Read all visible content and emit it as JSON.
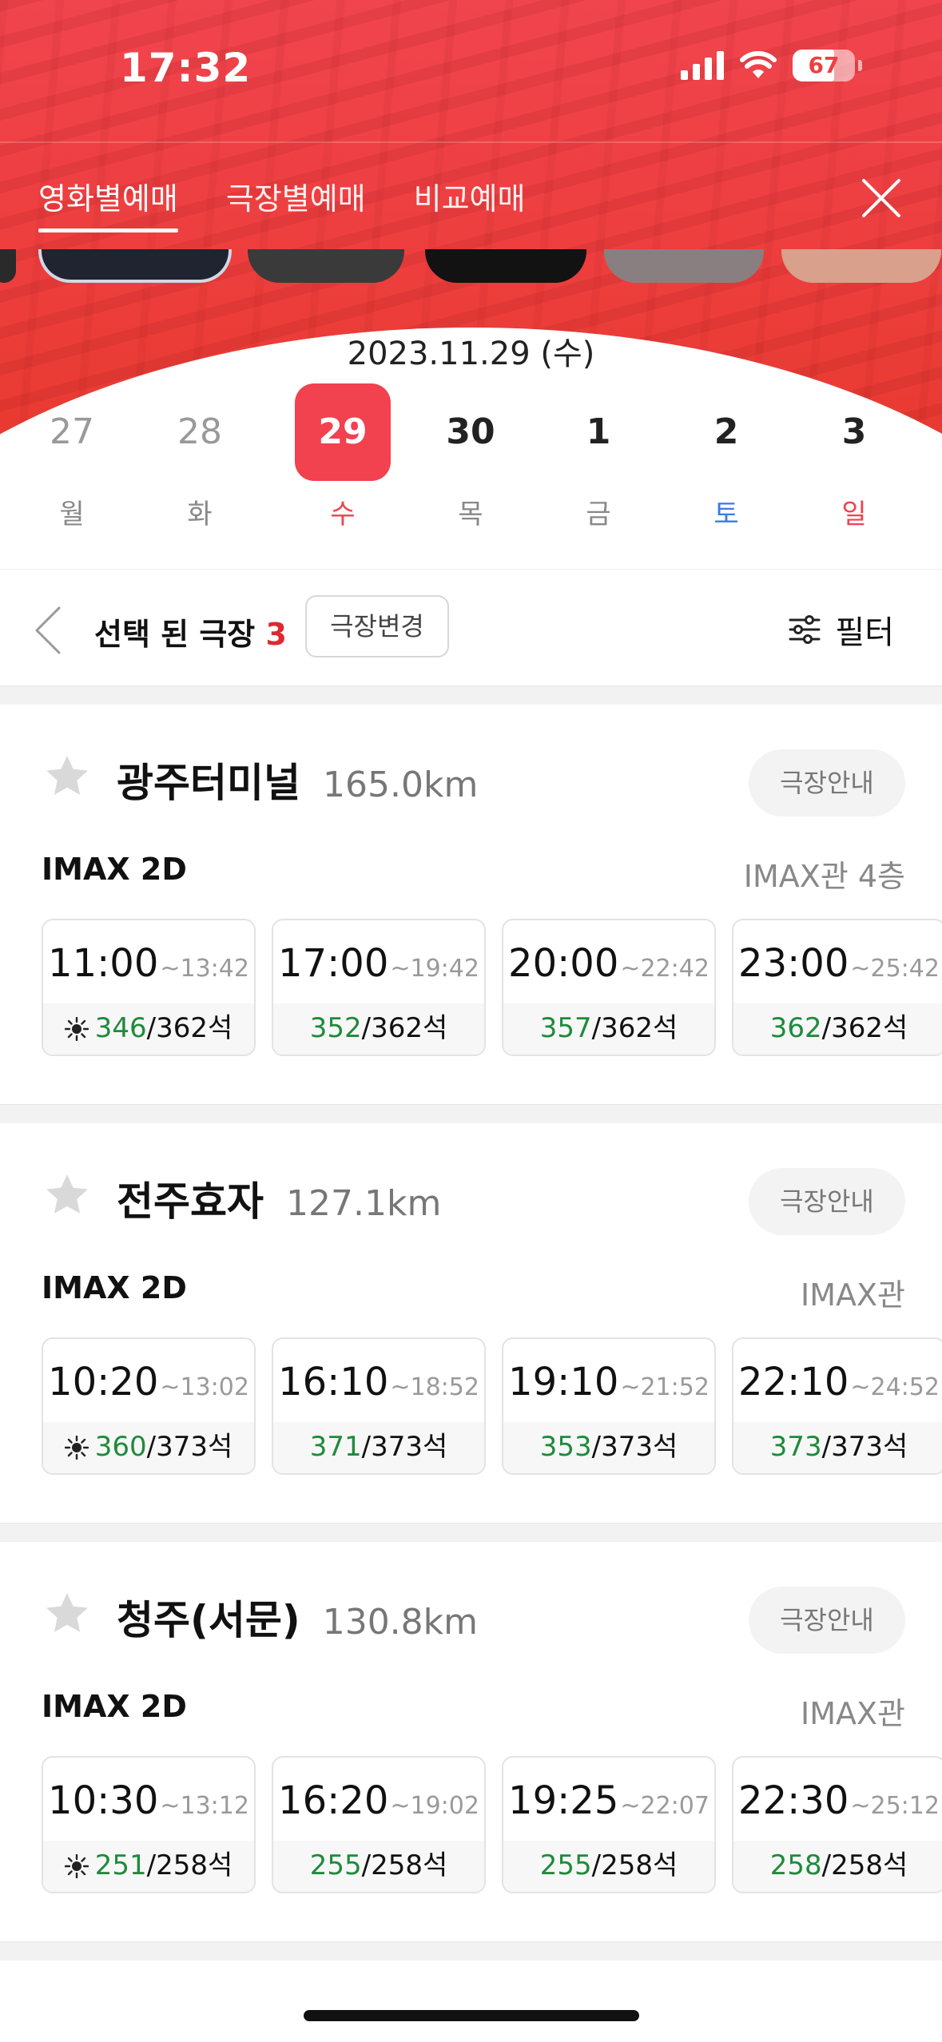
{
  "status_bar": {
    "time": "17:32",
    "battery": "67",
    "battery_level": 0.67
  },
  "tabs": [
    {
      "label": "영화별예매",
      "active": true
    },
    {
      "label": "극장별예매",
      "active": false
    },
    {
      "label": "비교예매",
      "active": false
    }
  ],
  "date_label": "2023.11.29 (수)",
  "days": [
    {
      "num": "27",
      "weekday": "월",
      "state": "past"
    },
    {
      "num": "28",
      "weekday": "화",
      "state": "past"
    },
    {
      "num": "29",
      "weekday": "수",
      "state": "selected"
    },
    {
      "num": "30",
      "weekday": "목",
      "state": "future"
    },
    {
      "num": "1",
      "weekday": "금",
      "state": "future"
    },
    {
      "num": "2",
      "weekday": "토",
      "state": "future"
    },
    {
      "num": "3",
      "weekday": "일",
      "state": "future"
    }
  ],
  "weekday_colors": {
    "selected": "#f2414f",
    "saturday": "#3a7be0",
    "sunday": "#f2414f",
    "default": "#888888"
  },
  "selector": {
    "label": "선택 된 극장",
    "count": "3",
    "change_button": "극장변경",
    "filter_label": "필터"
  },
  "theaters": [
    {
      "name": "광주터미널",
      "distance": "165.0km",
      "guide_button": "극장안내",
      "format": "IMAX 2D",
      "hall": "IMAX관 4층",
      "showtimes": [
        {
          "start": "11:00",
          "end": "~13:42",
          "available": "346",
          "total": "/362석",
          "morning": true
        },
        {
          "start": "17:00",
          "end": "~19:42",
          "available": "352",
          "total": "/362석",
          "morning": false
        },
        {
          "start": "20:00",
          "end": "~22:42",
          "available": "357",
          "total": "/362석",
          "morning": false
        },
        {
          "start": "23:00",
          "end": "~25:42",
          "available": "362",
          "total": "/362석",
          "morning": false
        }
      ]
    },
    {
      "name": "전주효자",
      "distance": "127.1km",
      "guide_button": "극장안내",
      "format": "IMAX 2D",
      "hall": "IMAX관",
      "showtimes": [
        {
          "start": "10:20",
          "end": "~13:02",
          "available": "360",
          "total": "/373석",
          "morning": true
        },
        {
          "start": "16:10",
          "end": "~18:52",
          "available": "371",
          "total": "/373석",
          "morning": false
        },
        {
          "start": "19:10",
          "end": "~21:52",
          "available": "353",
          "total": "/373석",
          "morning": false
        },
        {
          "start": "22:10",
          "end": "~24:52",
          "available": "373",
          "total": "/373석",
          "morning": false
        }
      ]
    },
    {
      "name": "청주(서문)",
      "distance": "130.8km",
      "guide_button": "극장안내",
      "format": "IMAX 2D",
      "hall": "IMAX관",
      "showtimes": [
        {
          "start": "10:30",
          "end": "~13:12",
          "available": "251",
          "total": "/258석",
          "morning": true
        },
        {
          "start": "16:20",
          "end": "~19:02",
          "available": "255",
          "total": "/258석",
          "morning": false
        },
        {
          "start": "19:25",
          "end": "~22:07",
          "available": "255",
          "total": "/258석",
          "morning": false
        },
        {
          "start": "22:30",
          "end": "~25:12",
          "available": "258",
          "total": "/258석",
          "morning": false
        }
      ]
    }
  ],
  "colors": {
    "accent": "#f2414f",
    "available": "#1f8a3c",
    "header_red": "#ee3f40"
  },
  "icons": [
    "signal-icon",
    "wifi-icon",
    "battery-icon",
    "close-icon",
    "back-chevron-icon",
    "filter-icon",
    "star-icon",
    "sun-icon"
  ]
}
